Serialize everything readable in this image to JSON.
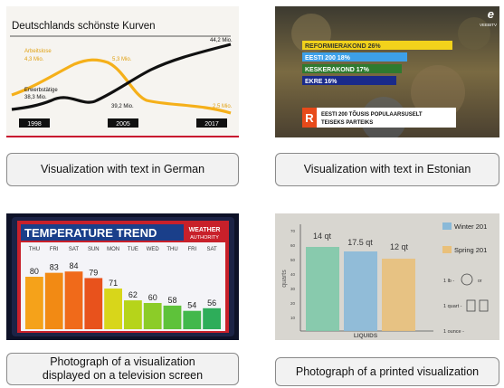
{
  "panels": [
    {
      "caption": "Visualization with text in German",
      "title": "Deutschlands schönste Kurven",
      "labels": {
        "unemployed_name": "Arbeitslose",
        "unemployed_start": "4,3 Mio.",
        "unemployed_peak": "5,3 Mio.",
        "unemployed_end": "2,5 Mio.",
        "employed_name": "Erwerbstätige",
        "employed_start": "38,3 Mio.",
        "employed_mid": "39,2 Mio.",
        "employed_end": "44,2 Mio."
      },
      "years": [
        "1998",
        "2005",
        "2017"
      ],
      "colors": {
        "unemployed": "#f5b01a",
        "employed": "#111111"
      }
    },
    {
      "caption": "Visualization with text in Estonian",
      "bars": [
        {
          "label": "REFORMIERAKOND 26%",
          "color": "#f2d21b",
          "text_color": "#3a3a2a"
        },
        {
          "label": "EESTI 200 18%",
          "color": "#3da0e8",
          "text_color": "#ffffff"
        },
        {
          "label": "KESKERAKOND 17%",
          "color": "#2f7a2f",
          "text_color": "#ffffff"
        },
        {
          "label": "EKRE 16%",
          "color": "#1a2a8a",
          "text_color": "#ffffff"
        }
      ],
      "headline": [
        "EESTI 200 TÕUSIS POPULAARSUSELT",
        "TEISEKS PARTEIKS"
      ],
      "logo_letter": "R",
      "channel": "VEEBITV"
    },
    {
      "caption": [
        "Photograph of a visualization",
        "displayed on a television screen"
      ],
      "title": "TEMPERATURE TREND",
      "brand": [
        "WEATHER",
        "AUTHORITY"
      ],
      "days": [
        "THU",
        "FRI",
        "SAT",
        "SUN",
        "MON",
        "TUE",
        "WED",
        "THU",
        "FRI",
        "SAT"
      ],
      "values": [
        "80",
        "83",
        "84",
        "79",
        "71",
        "62",
        "60",
        "58",
        "54",
        "56"
      ]
    },
    {
      "caption": "Photograph of a printed visualization",
      "ylabel": "quarts",
      "yticks": [
        "70",
        "60",
        "50",
        "40",
        "30",
        "20",
        "10"
      ],
      "bar_labels": [
        "14 qt",
        "17.5 qt",
        "12 qt"
      ],
      "xlabel": "LIQUIDS",
      "notes": [
        "Winter 201",
        "Spring 201"
      ],
      "conversions": [
        "1 lb -",
        "or",
        "1 quart -",
        "1 ounce -"
      ]
    }
  ]
}
